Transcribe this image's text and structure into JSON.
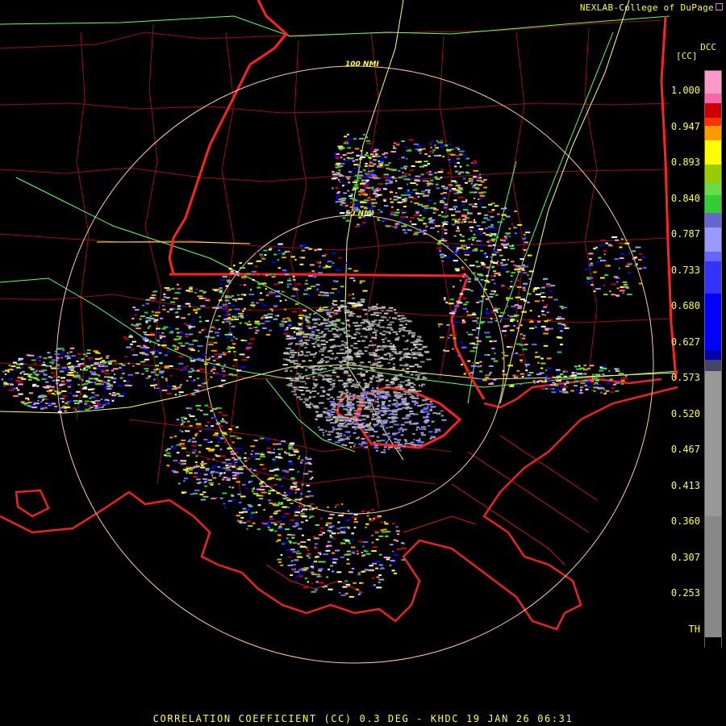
{
  "header": {
    "credit": "NEXLAB-College of DuPage"
  },
  "product": {
    "code": "DCC",
    "unit": "[CC]"
  },
  "range_rings": {
    "inner_label": "50 NMI",
    "outer_label": "100 NMI"
  },
  "legend": {
    "ticks": [
      "1.000",
      "0.947",
      "0.893",
      "0.840",
      "0.787",
      "0.733",
      "0.680",
      "0.627",
      "0.573",
      "0.520",
      "0.467",
      "0.413",
      "0.360",
      "0.307",
      "0.253",
      "TH"
    ],
    "colors": {
      "high_pink": "#ff99cc",
      "red": "#cc0000",
      "orange": "#ff9900",
      "yellow": "#ffff00",
      "green": "#33cc33",
      "lavender": "#9999ff",
      "blue": "#0000ff",
      "gray": "#999999"
    }
  },
  "footer": {
    "caption": "CORRELATION COEFFICIENT (CC) 0.3 DEG - KHDC 19 JAN 26 06:31"
  },
  "map_colors": {
    "state_border": "#ff2222",
    "county_border": "#aa1111",
    "coast": "#ee2222",
    "interstate": "#ffff66",
    "highway": "#66ff66",
    "range_ring": "#ffcc99"
  }
}
